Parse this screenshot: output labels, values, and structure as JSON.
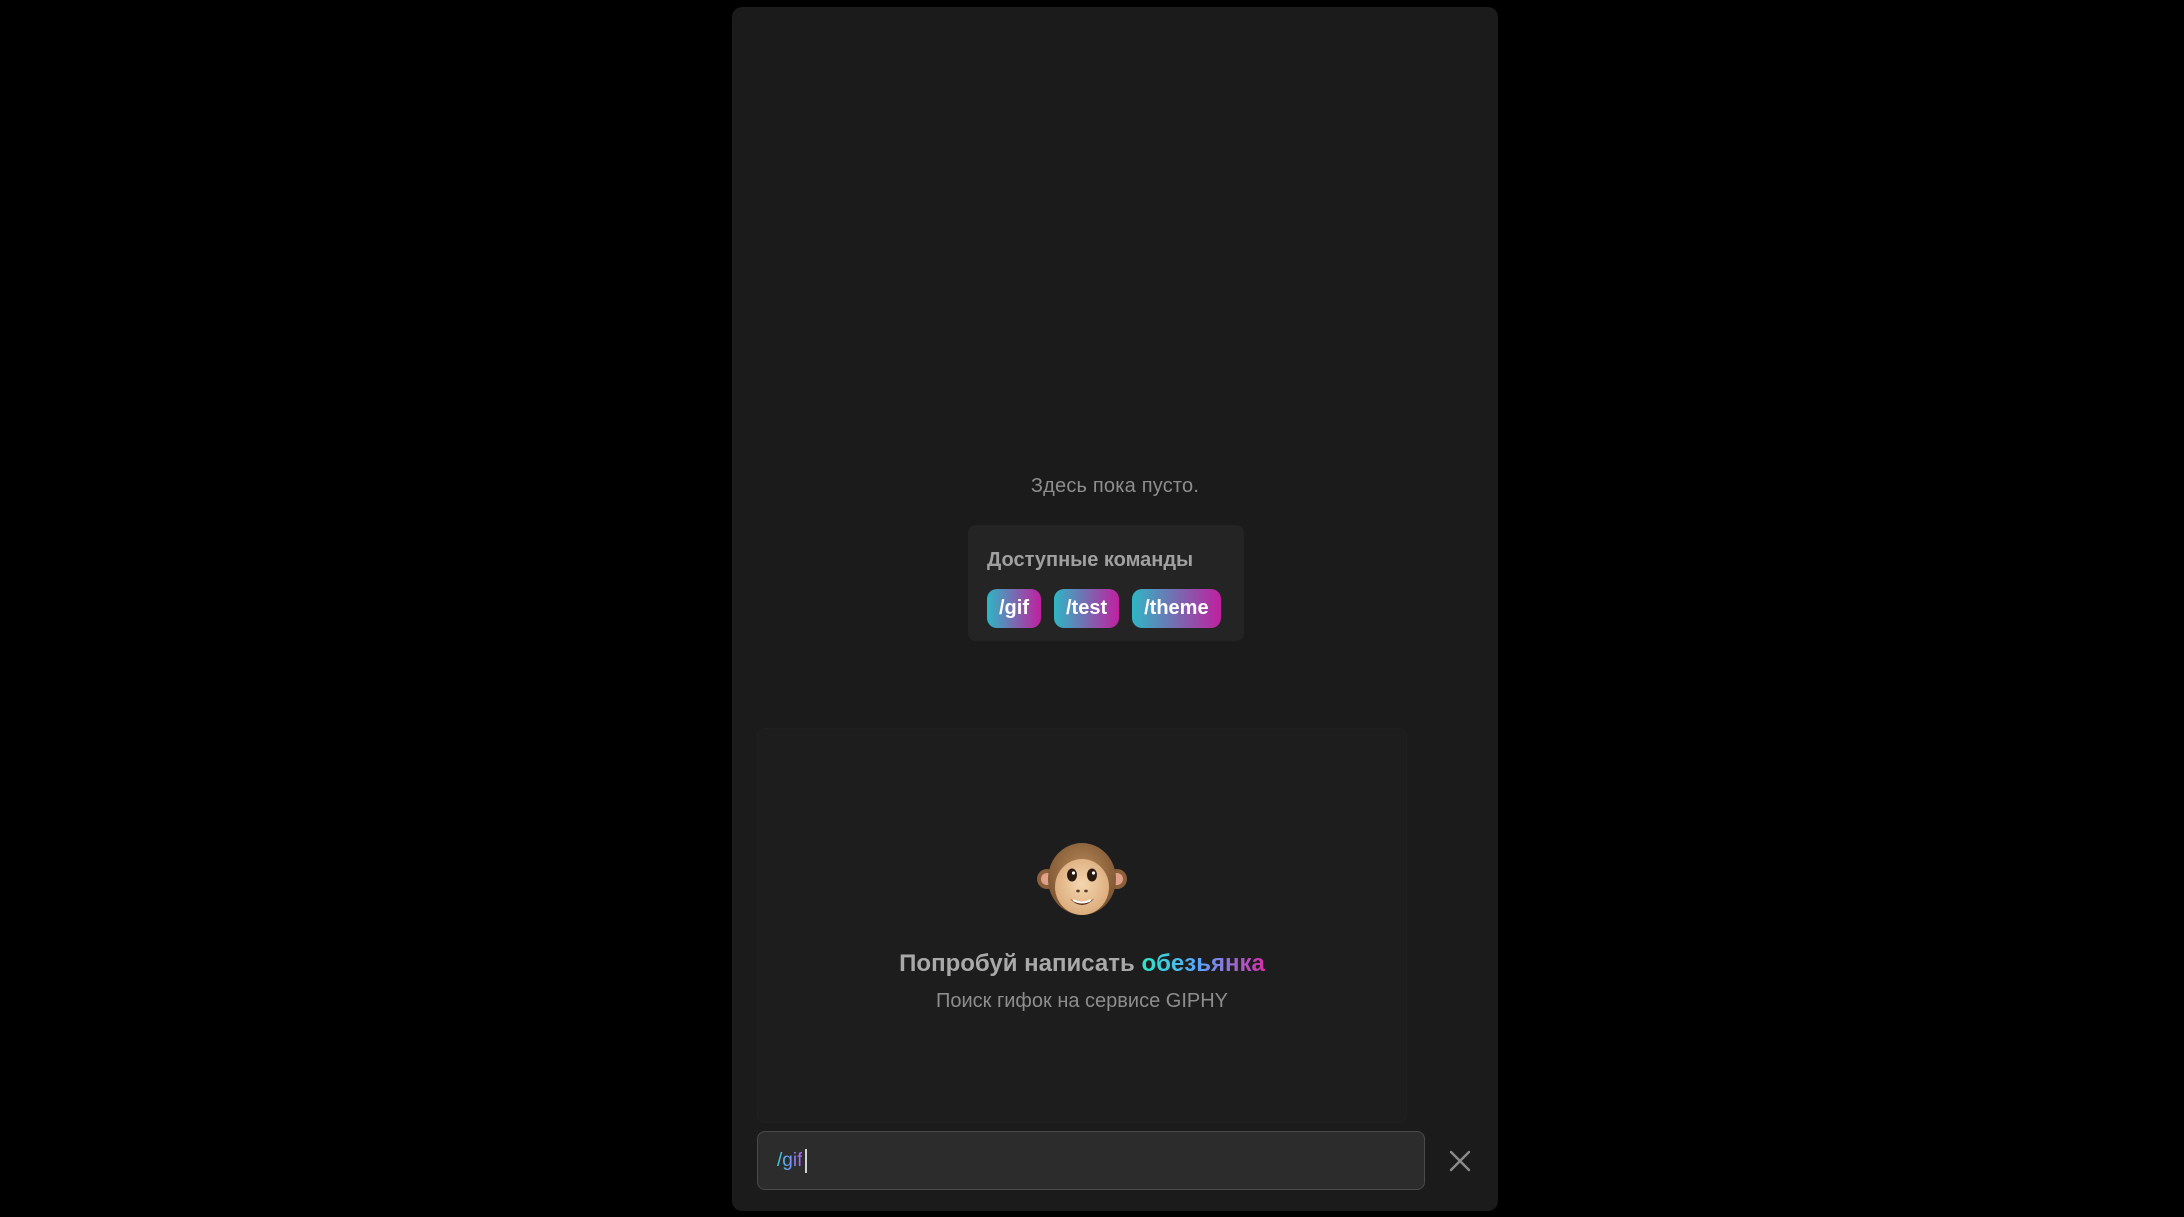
{
  "chat": {
    "empty_text": "Здесь пока пусто."
  },
  "commands": {
    "title": "Доступные команды",
    "items": [
      {
        "label": "/gif",
        "gradient": [
          "#2fb6c4",
          "#c0209f"
        ]
      },
      {
        "label": "/test",
        "gradient": [
          "#2fb6c4",
          "#c0209f"
        ]
      },
      {
        "label": "/theme",
        "gradient": [
          "#2fb6c4",
          "#c0209f"
        ]
      }
    ]
  },
  "gif_panel": {
    "icon": "monkey-icon",
    "hint_prefix": "Попробуй написать",
    "hint_word": "обезьянка",
    "subtitle": "Поиск гифок на сервисе GIPHY"
  },
  "input": {
    "value": "/gif"
  },
  "close_icon": "close-icon",
  "colors": {
    "background": "#000000",
    "panel": "#1b1b1b",
    "accent_start": "#2fb6c4",
    "accent_end": "#c0209f"
  }
}
